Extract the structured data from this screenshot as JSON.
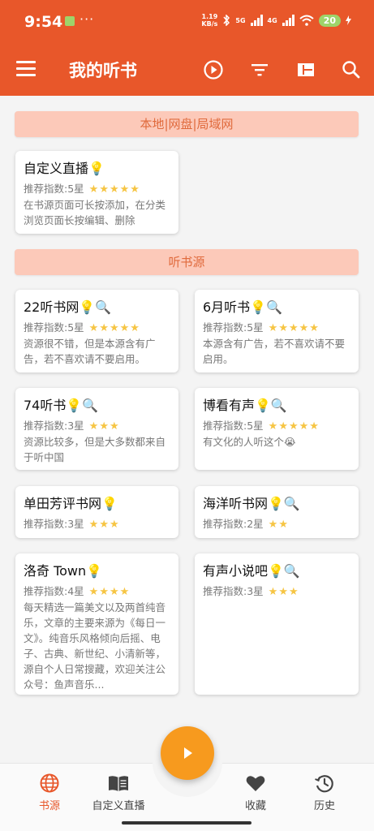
{
  "status_bar": {
    "time": "9:54",
    "more": "···",
    "net_speed_value": "1.19",
    "net_speed_unit": "KB/s",
    "signal_1": "5G",
    "signal_2": "4G",
    "battery": "20"
  },
  "app_bar": {
    "title": "我的听书",
    "icons": [
      "menu-icon",
      "play-circle-icon",
      "filter-icon",
      "layout-icon",
      "search-icon"
    ]
  },
  "sections": [
    {
      "header": "本地|网盘|局域网",
      "cards": [
        {
          "title": "自定义直播💡",
          "rating_label": "推荐指数:5星",
          "stars": "★★★★★",
          "desc": "在书源页面可长按添加，在分类浏览页面长按编辑、删除"
        }
      ]
    },
    {
      "header": "听书源",
      "cards": [
        {
          "title": "22听书网💡🔍",
          "rating_label": "推荐指数:5星",
          "stars": "★★★★★",
          "desc": "资源很不错，但是本源含有广告，若不喜欢请不要启用。"
        },
        {
          "title": "6月听书💡🔍",
          "rating_label": "推荐指数:5星",
          "stars": "★★★★★",
          "desc": "本源含有广告，若不喜欢请不要启用。"
        },
        {
          "title": "74听书💡🔍",
          "rating_label": "推荐指数:3星",
          "stars": "★★★",
          "desc": "资源比较多，但是大多数都来自于听中国"
        },
        {
          "title": "博看有声💡🔍",
          "rating_label": "推荐指数:5星",
          "stars": "★★★★★",
          "desc": "有文化的人听这个😭"
        },
        {
          "title": "单田芳评书网💡",
          "rating_label": "推荐指数:3星",
          "stars": "★★★",
          "desc": ""
        },
        {
          "title": "海洋听书网💡🔍",
          "rating_label": "推荐指数:2星",
          "stars": "★★",
          "desc": ""
        },
        {
          "title": "洛奇 Town💡",
          "rating_label": "推荐指数:4星",
          "stars": "★★★★",
          "desc": "每天精选一篇美文以及两首纯音乐，文章的主要来源为《每日一文》。纯音乐风格倾向后摇、电子、古典、新世纪、小清新等，源自个人日常搜藏，欢迎关注公众号：鱼声音乐..."
        },
        {
          "title": "有声小说吧💡🔍",
          "rating_label": "推荐指数:3星",
          "stars": "★★★",
          "desc": ""
        }
      ]
    }
  ],
  "bottom_nav": [
    {
      "label": "书源",
      "icon": "globe-icon",
      "active": true
    },
    {
      "label": "自定义直播",
      "icon": "book-icon",
      "active": false
    },
    {
      "label": "收藏",
      "icon": "heart-icon",
      "active": false
    },
    {
      "label": "历史",
      "icon": "history-icon",
      "active": false
    }
  ],
  "fab": {
    "icon": "play-icon"
  },
  "colors": {
    "primary": "#E8572A",
    "section_bg": "#FCC9B9",
    "star": "#F6C544",
    "fab": "#F79A1E"
  }
}
